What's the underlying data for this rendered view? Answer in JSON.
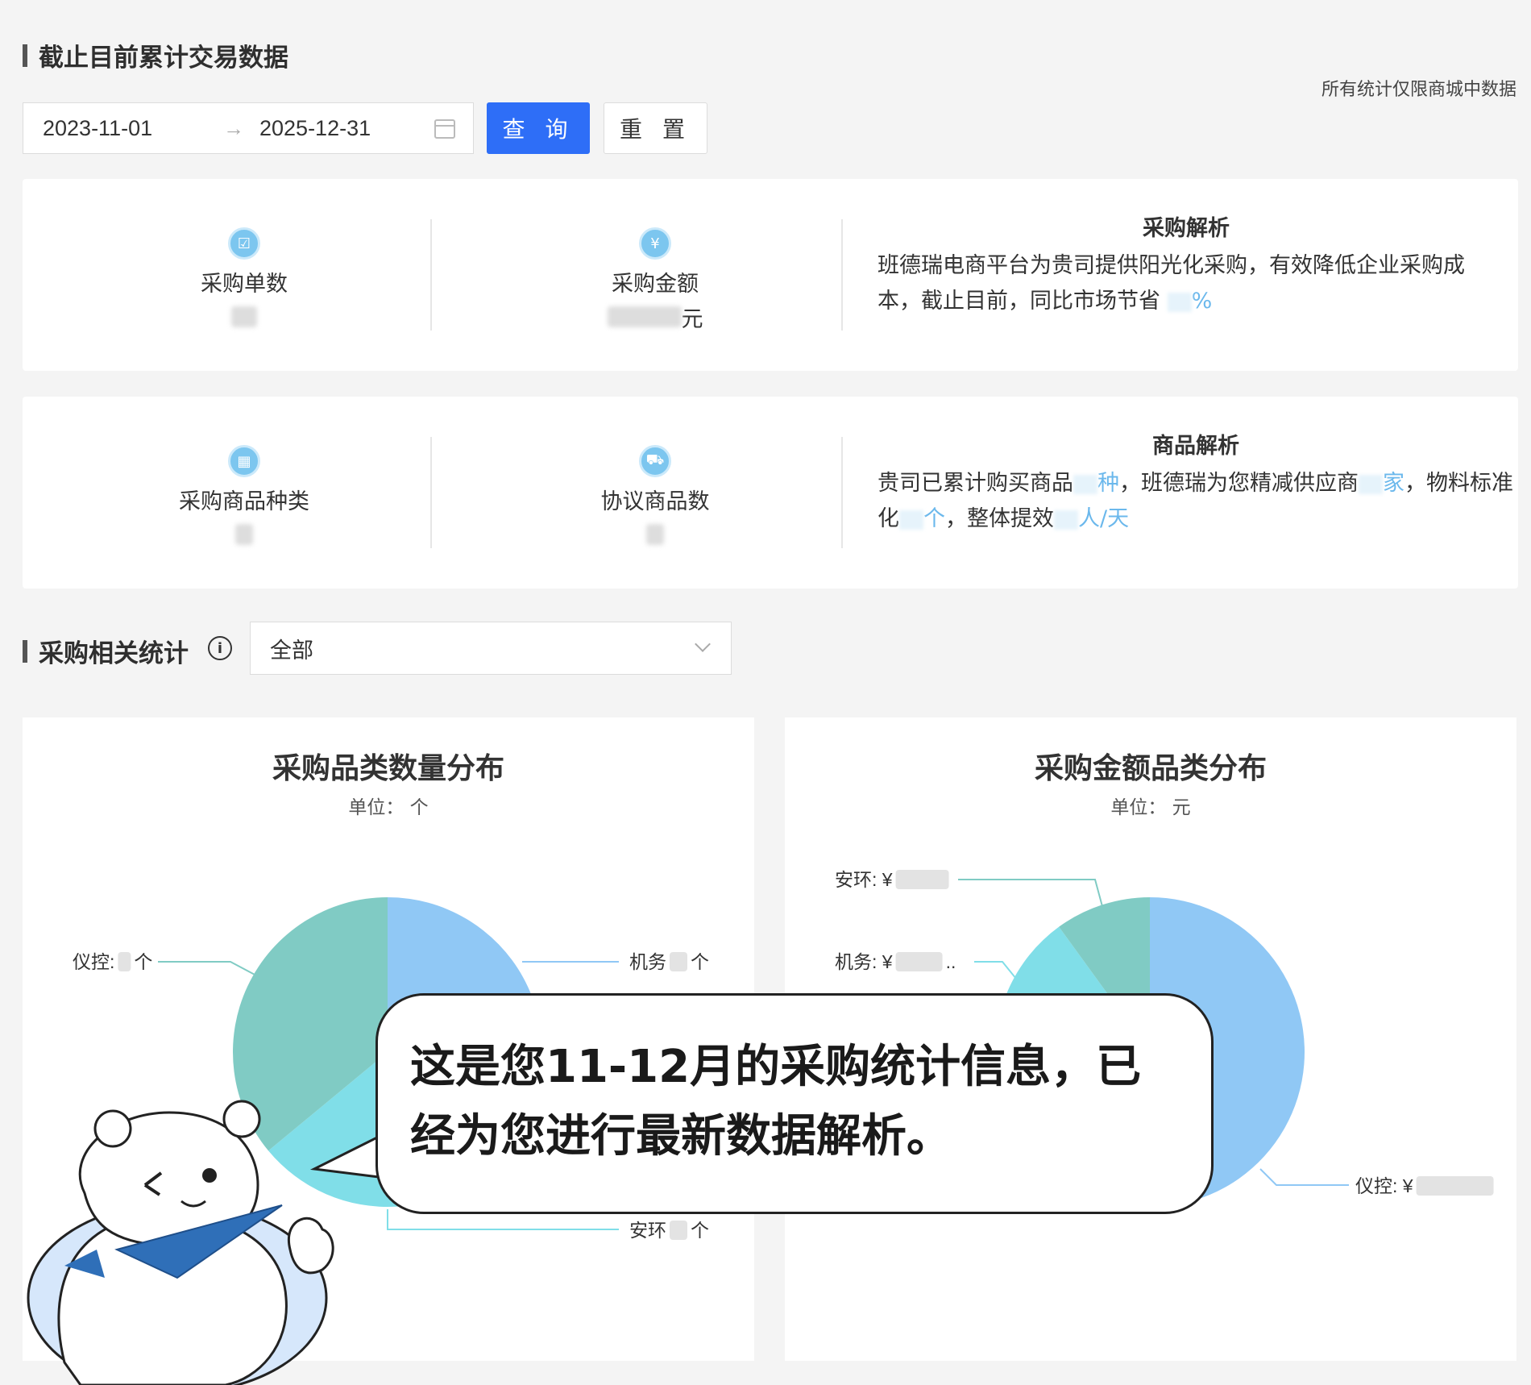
{
  "header": {
    "title": "截止目前累计交易数据",
    "note": "所有统计仅限商城中数据"
  },
  "filters": {
    "start_date": "2023-11-01",
    "end_date": "2025-12-31",
    "query_label": "查 询",
    "reset_label": "重 置"
  },
  "purchase_card": {
    "order_count_label": "采购单数",
    "amount_label": "采购金额",
    "amount_unit": "元",
    "analysis_title": "采购解析",
    "analysis_text_1": "班德瑞电商平台为贵司提供阳光化采购，有效降低企业采购成本，截止目前，同比市场节省",
    "analysis_unit": "%"
  },
  "goods_card": {
    "category_label": "采购商品种类",
    "agreement_label": "协议商品数",
    "analysis_title": "商品解析",
    "text_a": "贵司已累计购买商品",
    "unit_a": "种",
    "text_b": "，班德瑞为您精减供应商",
    "unit_b": "家",
    "text_c": "，物料标准化",
    "unit_c": "个",
    "text_d": "，整体提效",
    "unit_d": "人/天"
  },
  "stats_section": {
    "title": "采购相关统计",
    "select_value": "全部"
  },
  "colors": {
    "blue": "#90c8f5",
    "teal": "#80cbc4",
    "cyan": "#80dee8",
    "accent": "#2e6ef7"
  },
  "chart_data": [
    {
      "type": "pie",
      "title": "采购品类数量分布",
      "unit": "单位： 个",
      "slices": [
        {
          "name": "机务",
          "label": "机务",
          "suffix": "个",
          "color": "#90c8f5"
        },
        {
          "name": "安环",
          "label": "安环",
          "suffix": "个",
          "color": "#80dee8"
        },
        {
          "name": "仪控",
          "label": "仪控:",
          "suffix": "个",
          "color": "#80cbc4"
        }
      ]
    },
    {
      "type": "pie",
      "title": "采购金额品类分布",
      "unit": "单位： 元",
      "slices": [
        {
          "name": "仪控",
          "label": "仪控: ¥",
          "color": "#90c8f5"
        },
        {
          "name": "机务",
          "label": "机务: ¥",
          "suffix": "..",
          "color": "#80dee8"
        },
        {
          "name": "安环",
          "label": "安环: ¥",
          "color": "#80cbc4"
        }
      ]
    }
  ],
  "bubble": {
    "text": "这是您11-12月的采购统计信息，已经为您进行最新数据解析。"
  }
}
